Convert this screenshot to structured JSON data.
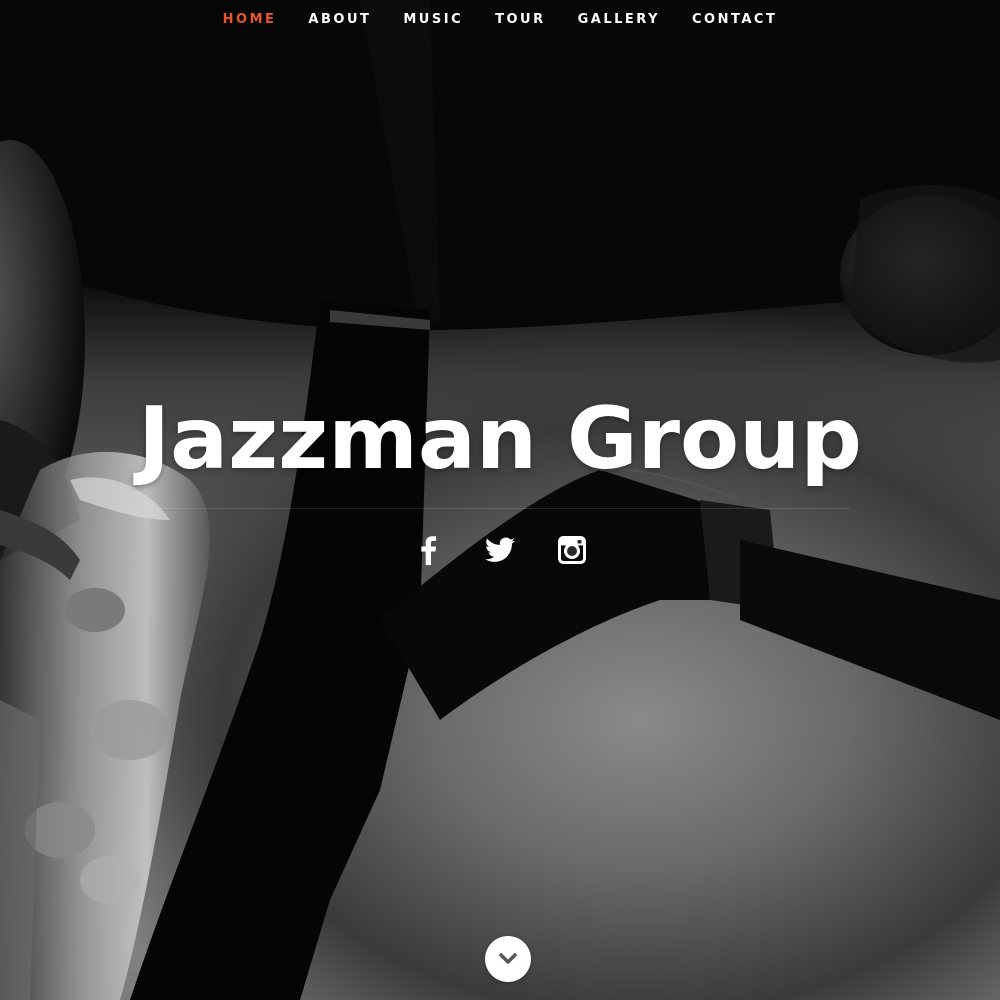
{
  "nav": {
    "items": [
      {
        "label": "HOME",
        "active": true
      },
      {
        "label": "ABOUT",
        "active": false
      },
      {
        "label": "MUSIC",
        "active": false
      },
      {
        "label": "TOUR",
        "active": false
      },
      {
        "label": "GALLERY",
        "active": false
      },
      {
        "label": "CONTACT",
        "active": false
      }
    ],
    "active_color": "#e8572a",
    "text_color": "#ffffff"
  },
  "hero": {
    "title": "Jazzman Group",
    "background_image": "black-and-white-saxophone-and-microphone-photo"
  },
  "social": {
    "icons": [
      "facebook-icon",
      "twitter-icon",
      "instagram-icon"
    ]
  },
  "scroll_button": {
    "icon": "chevron-down-icon"
  }
}
